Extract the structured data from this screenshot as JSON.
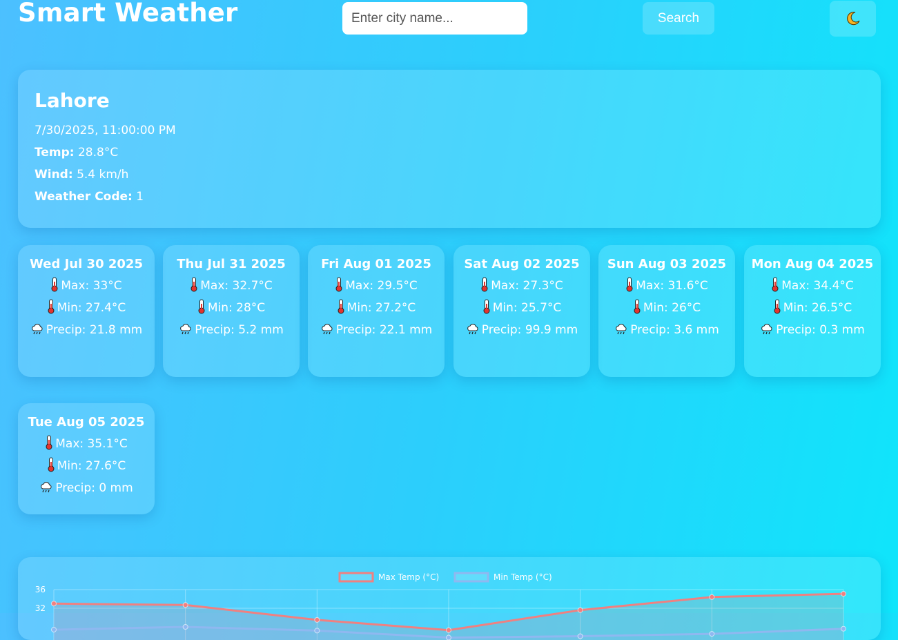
{
  "header": {
    "title": "Smart Weather",
    "search_placeholder": "Enter city name...",
    "search_label": "Search",
    "theme_icon": "moon-icon"
  },
  "current": {
    "city": "Lahore",
    "datetime": "7/30/2025, 11:00:00 PM",
    "temp_label": "Temp:",
    "temp_value": "28.8°C",
    "wind_label": "Wind:",
    "wind_value": "5.4 km/h",
    "code_label": "Weather Code:",
    "code_value": "1"
  },
  "forecast": [
    {
      "date": "Wed Jul 30 2025",
      "max": "Max: 33°C",
      "min": "Min: 27.4°C",
      "precip": "Precip: 21.8 mm"
    },
    {
      "date": "Thu Jul 31 2025",
      "max": "Max: 32.7°C",
      "min": "Min: 28°C",
      "precip": "Precip: 5.2 mm"
    },
    {
      "date": "Fri Aug 01 2025",
      "max": "Max: 29.5°C",
      "min": "Min: 27.2°C",
      "precip": "Precip: 22.1 mm"
    },
    {
      "date": "Sat Aug 02 2025",
      "max": "Max: 27.3°C",
      "min": "Min: 25.7°C",
      "precip": "Precip: 99.9 mm"
    },
    {
      "date": "Sun Aug 03 2025",
      "max": "Max: 31.6°C",
      "min": "Min: 26°C",
      "precip": "Precip: 3.6 mm"
    },
    {
      "date": "Mon Aug 04 2025",
      "max": "Max: 34.4°C",
      "min": "Min: 26.5°C",
      "precip": "Precip: 0.3 mm"
    },
    {
      "date": "Tue Aug 05 2025",
      "max": "Max: 35.1°C",
      "min": "Min: 27.6°C",
      "precip": "Precip: 0 mm"
    }
  ],
  "chart_data": {
    "type": "line",
    "x": [
      "Wed Jul 30 2025",
      "Thu Jul 31 2025",
      "Fri Aug 01 2025",
      "Sat Aug 02 2025",
      "Sun Aug 03 2025",
      "Mon Aug 04 2025",
      "Tue Aug 05 2025"
    ],
    "series": [
      {
        "name": "Max Temp (°C)",
        "values": [
          33,
          32.7,
          29.5,
          27.3,
          31.6,
          34.4,
          35.1
        ],
        "color": "#f08080"
      },
      {
        "name": "Min Temp (°C)",
        "values": [
          27.4,
          28,
          27.2,
          25.7,
          26,
          26.5,
          27.6
        ],
        "color": "#8fb8f0"
      }
    ],
    "yticks": [
      "36",
      "32"
    ],
    "ylim": [
      24,
      36
    ],
    "legend_position": "top-center",
    "grid": true
  },
  "colors": {
    "bg_start": "#4cc0ff",
    "bg_end": "#0fe5fb",
    "max_line": "#f08080",
    "min_line": "#8fb8f0"
  }
}
